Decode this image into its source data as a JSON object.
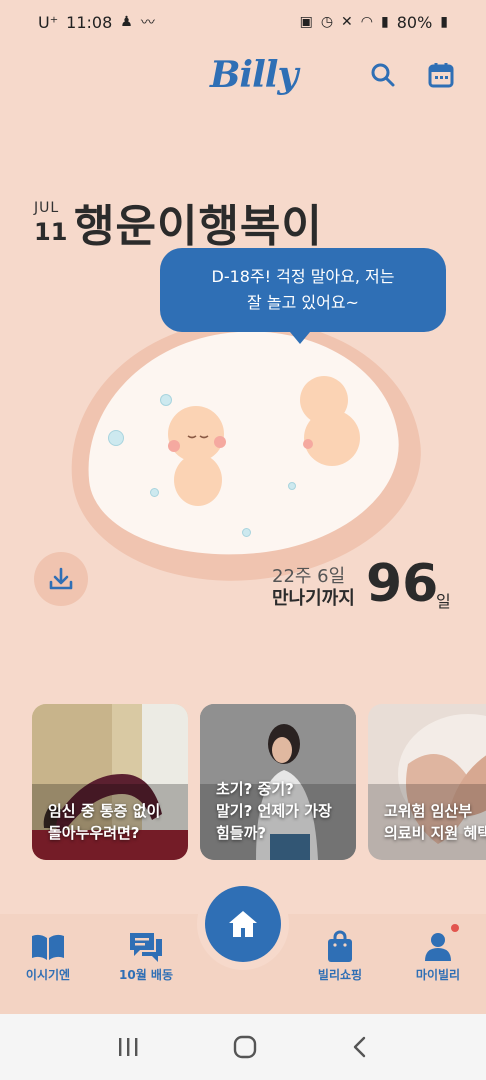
{
  "status": {
    "carrier": "U⁺",
    "time": "11:08",
    "battery": "80%"
  },
  "header": {
    "logo": "Billy",
    "search_icon": "search-icon",
    "calendar_icon": "calendar-icon"
  },
  "profile": {
    "month": "JUL",
    "day": "11",
    "name": "행운이행복이"
  },
  "speech": {
    "line1": "D-18주! 걱정 말아요, 저는",
    "line2": "잘 놀고 있어요~"
  },
  "progress": {
    "week": "22주 6일",
    "until_label": "만나기까지",
    "days_left": "96",
    "days_unit": "일"
  },
  "cards": [
    {
      "line1": "임신 중 통증 없이",
      "line2": "돌아누우려면?"
    },
    {
      "line1": "초기? 중기?",
      "line2": "말기? 언제가 가장",
      "line3": "힘들까?"
    },
    {
      "line1": "고위험 임산부",
      "line2": "의료비 지원 혜택"
    }
  ],
  "nav": {
    "items": [
      {
        "label": "이시기엔"
      },
      {
        "label": "10월 배동"
      },
      {
        "label": "빌리쇼핑"
      },
      {
        "label": "마이빌리"
      }
    ]
  },
  "colors": {
    "accent": "#2f6fb5",
    "background": "#f6d9cb",
    "notification": "#e2554e"
  }
}
